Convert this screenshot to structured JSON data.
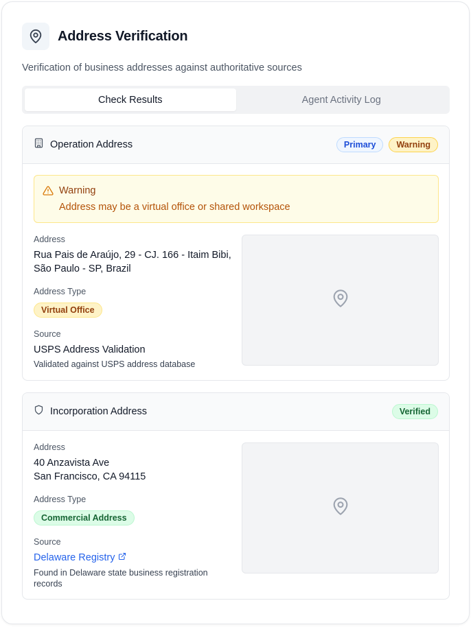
{
  "header": {
    "title": "Address Verification",
    "subtitle": "Verification of business addresses against authoritative sources"
  },
  "tabs": [
    {
      "label": "Check Results",
      "active": true
    },
    {
      "label": "Agent Activity Log",
      "active": false
    }
  ],
  "operation": {
    "title": "Operation Address",
    "badges": [
      "Primary",
      "Warning"
    ],
    "alert": {
      "title": "Warning",
      "message": "Address may be a virtual office or shared workspace"
    },
    "address_label": "Address",
    "address_line1": "Rua Pais de Araújo, 29 - CJ. 166 - Itaim Bibi,",
    "address_line2": "São Paulo - SP, Brazil",
    "type_label": "Address Type",
    "type_value": "Virtual Office",
    "source_label": "Source",
    "source_value": "USPS Address Validation",
    "source_note": "Validated against USPS address database"
  },
  "incorporation": {
    "title": "Incorporation Address",
    "badges": [
      "Verified"
    ],
    "address_label": "Address",
    "address_line1": "40 Anzavista Ave",
    "address_line2": "San Francisco, CA 94115",
    "type_label": "Address Type",
    "type_value": "Commercial Address",
    "source_label": "Source",
    "source_value": "Delaware Registry",
    "source_note": "Found in Delaware state business registration records"
  },
  "colors": {
    "warning": "#92400e",
    "success": "#166534",
    "link": "#2563eb",
    "primary_badge": "#1d4ed8"
  },
  "icons": {
    "header": "map-pin-icon",
    "operation": "building-icon",
    "incorporation": "shield-icon",
    "alert": "warning-triangle-icon",
    "map": "map-pin-icon",
    "link": "external-link-icon"
  }
}
